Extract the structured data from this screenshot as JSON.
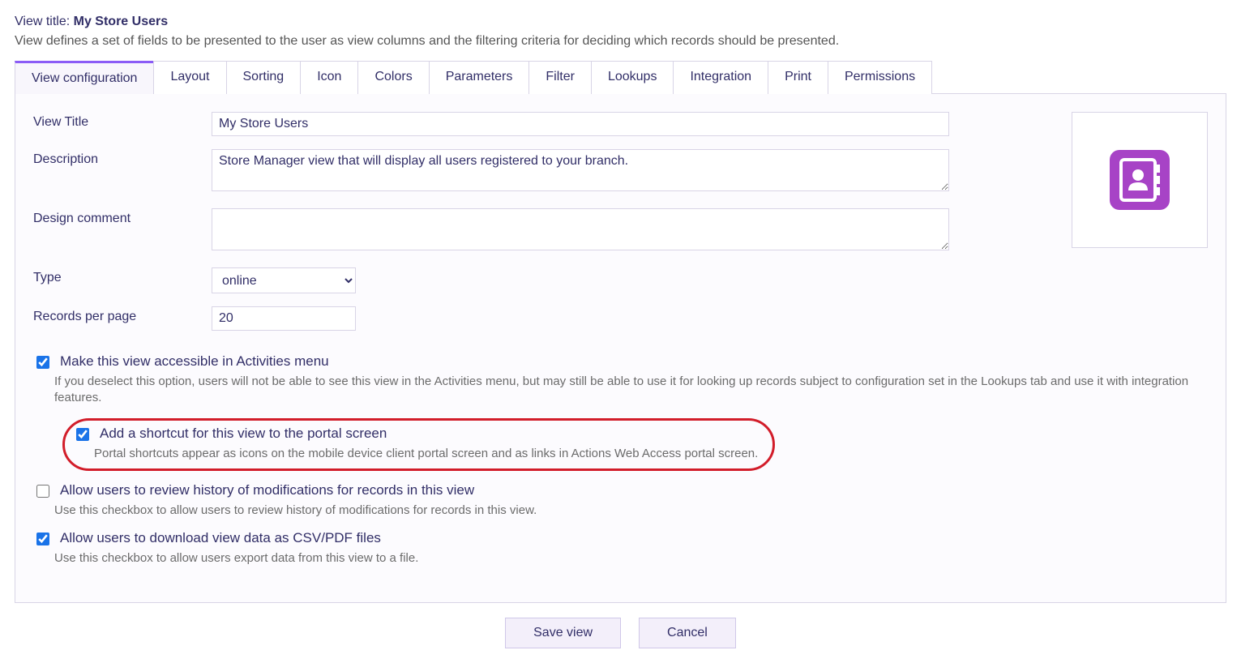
{
  "header": {
    "label": "View title: ",
    "value": "My Store Users",
    "desc": "View defines a set of fields to be presented to the user as view columns and the filtering criteria for deciding which records should be presented."
  },
  "tabs": [
    {
      "label": "View configuration",
      "active": true
    },
    {
      "label": "Layout"
    },
    {
      "label": "Sorting"
    },
    {
      "label": "Icon"
    },
    {
      "label": "Colors"
    },
    {
      "label": "Parameters"
    },
    {
      "label": "Filter"
    },
    {
      "label": "Lookups"
    },
    {
      "label": "Integration"
    },
    {
      "label": "Print"
    },
    {
      "label": "Permissions"
    }
  ],
  "form": {
    "viewTitle": {
      "label": "View Title",
      "value": "My Store Users"
    },
    "description": {
      "label": "Description",
      "value": "Store Manager view that will display all users registered to your branch."
    },
    "designComment": {
      "label": "Design comment",
      "value": ""
    },
    "type": {
      "label": "Type",
      "value": "online"
    },
    "recordsPerPage": {
      "label": "Records per page",
      "value": "20"
    }
  },
  "checks": {
    "accessible": {
      "checked": true,
      "title": "Make this view accessible in Activities menu",
      "help": "If you deselect this option, users will not be able to see this view in the Activities menu, but may still be able to use it for looking up records subject to configuration set in the Lookups tab and use it with integration features."
    },
    "shortcut": {
      "checked": true,
      "title": "Add a shortcut for this view to the portal screen",
      "help": "Portal shortcuts appear as icons on the mobile device client portal screen and as links in Actions Web Access portal screen."
    },
    "history": {
      "checked": false,
      "title": "Allow users to review history of modifications for records in this view",
      "help": "Use this checkbox to allow users to review history of modifications for records in this view."
    },
    "download": {
      "checked": true,
      "title": "Allow users to download view data as CSV/PDF files",
      "help": "Use this checkbox to allow users export data from this view to a file."
    }
  },
  "buttons": {
    "save": "Save view",
    "cancel": "Cancel"
  },
  "iconName": "contacts-book-icon"
}
